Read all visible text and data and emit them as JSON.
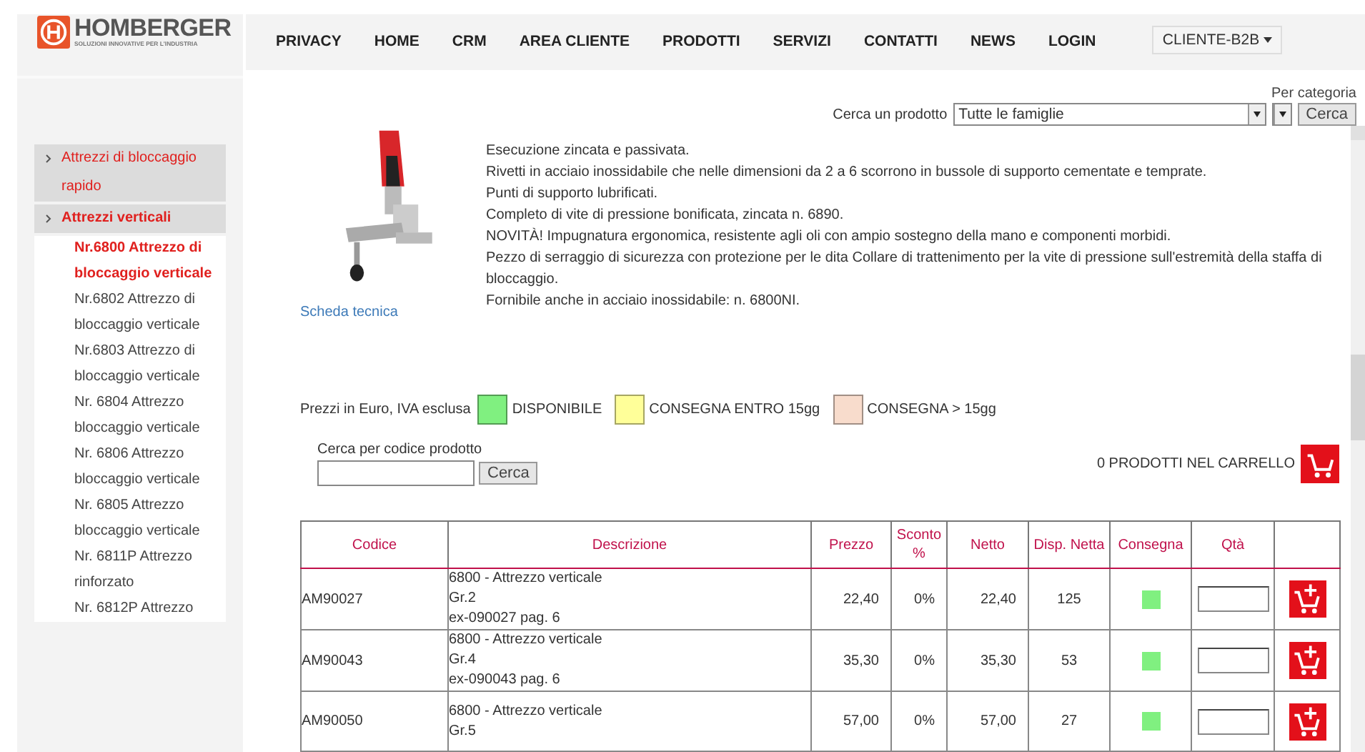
{
  "header": {
    "logo": {
      "name": "HOMBERGER",
      "tagline": "SOLUZIONI INNOVATIVE PER L'INDUSTRIA"
    },
    "nav": [
      "PRIVACY",
      "HOME",
      "CRM",
      "AREA CLIENTE",
      "PRODOTTI",
      "SERVIZI",
      "CONTATTI",
      "NEWS",
      "LOGIN"
    ],
    "user_menu": "CLIENTE-B2B"
  },
  "sidebar": {
    "items": [
      {
        "label": "Attrezzi di bloccaggio rapido"
      },
      {
        "label": "Attrezzi verticali",
        "children": [
          {
            "label": "Nr.6800 Attrezzo di bloccaggio verticale",
            "selected": true
          },
          {
            "label": "Nr.6802 Attrezzo di bloccaggio verticale",
            "selected": false
          },
          {
            "label": "Nr.6803 Attrezzo di bloccaggio verticale",
            "selected": false
          },
          {
            "label": "Nr. 6804 Attrezzo bloccaggio verticale",
            "selected": false
          },
          {
            "label": "Nr. 6806 Attrezzo bloccaggio verticale",
            "selected": false
          },
          {
            "label": "Nr. 6805 Attrezzo bloccaggio verticale",
            "selected": false
          },
          {
            "label": "Nr. 6811P Attrezzo rinforzato",
            "selected": false
          },
          {
            "label": "Nr. 6812P Attrezzo",
            "selected": false
          }
        ]
      }
    ]
  },
  "product_search": {
    "category_label": "Per categoria",
    "label": "Cerca un prodotto",
    "family_select": "Tutte le famiglie",
    "button": "Cerca"
  },
  "product": {
    "description_lines": [
      "Esecuzione zincata e passivata.",
      "Rivetti in acciaio inossidabile che nelle dimensioni da 2 a 6 scorrono in bussole di supporto cementate e temprate.",
      "Punti di supporto lubrificati.",
      "Completo di vite di pressione bonificata, zincata n. 6890.",
      "NOVITÀ! Impugnatura ergonomica, resistente agli oli con ampio sostegno della mano e componenti morbidi.",
      "Pezzo di serraggio di sicurezza con protezione per le dita Collare di trattenimento per la vite di pressione sull'estremità della staffa di bloccaggio.",
      "Fornibile anche in acciaio inossidabile: n. 6800NI."
    ],
    "datasheet_link": "Scheda tecnica"
  },
  "legend": {
    "note": "Prezzi in Euro, IVA esclusa",
    "items": [
      {
        "label": "DISPONIBILE",
        "color": "#80f080"
      },
      {
        "label": "CONSEGNA ENTRO 15gg",
        "color": "#ffff99"
      },
      {
        "label": "CONSEGNA > 15gg",
        "color": "#f8dccc"
      }
    ]
  },
  "code_search": {
    "label": "Cerca per codice prodotto",
    "button": "Cerca"
  },
  "cart": {
    "count_text": "0 PRODOTTI NEL CARRELLO"
  },
  "table": {
    "columns": [
      "Codice",
      "Descrizione",
      "Prezzo",
      "Sconto %",
      "Netto",
      "Disp. Netta",
      "Consegna",
      "Qtà"
    ],
    "rows": [
      {
        "code": "AM90027",
        "description": [
          "6800 - Attrezzo verticale",
          "Gr.2",
          "ex-090027 pag. 6"
        ],
        "price": "22,40",
        "discount": "0%",
        "net": "22,40",
        "available": "125",
        "color": "#80f080"
      },
      {
        "code": "AM90043",
        "description": [
          "6800 - Attrezzo verticale",
          "Gr.4",
          "ex-090043 pag. 6"
        ],
        "price": "35,30",
        "discount": "0%",
        "net": "35,30",
        "available": "53",
        "color": "#80f080"
      },
      {
        "code": "AM90050",
        "description": [
          "6800 - Attrezzo verticale",
          "Gr.5"
        ],
        "price": "57,00",
        "discount": "0%",
        "net": "57,00",
        "available": "27",
        "color": "#80f080"
      }
    ]
  }
}
